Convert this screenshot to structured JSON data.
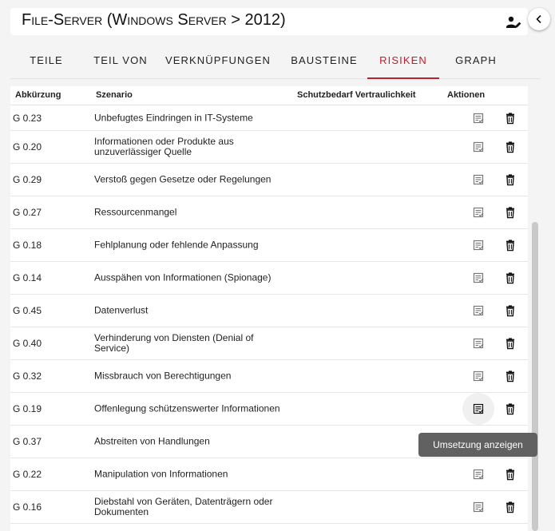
{
  "header": {
    "title": "File-Server (Windows Server > 2012)"
  },
  "tabs": [
    {
      "label": "Teile"
    },
    {
      "label": "Teil von"
    },
    {
      "label": "Verknüpfungen"
    },
    {
      "label": "Bausteine"
    },
    {
      "label": "Risiken",
      "active": true
    },
    {
      "label": "Graph"
    }
  ],
  "table": {
    "columns": [
      "Abkürzung",
      "Szenario",
      "Schutzbedarf Vertraulichkeit",
      "Aktionen"
    ],
    "rows": [
      {
        "id": "G 0.23",
        "scenario": "Unbefugtes Eindringen in IT-Systeme"
      },
      {
        "id": "G 0.20",
        "scenario": "Informationen oder Produkte aus unzuverlässiger Quelle"
      },
      {
        "id": "G 0.29",
        "scenario": "Verstoß gegen Gesetze oder Regelungen"
      },
      {
        "id": "G 0.27",
        "scenario": "Ressourcenmangel"
      },
      {
        "id": "G 0.18",
        "scenario": "Fehlplanung oder fehlende Anpassung"
      },
      {
        "id": "G 0.14",
        "scenario": "Ausspähen von Informationen (Spionage)"
      },
      {
        "id": "G 0.45",
        "scenario": "Datenverlust"
      },
      {
        "id": "G 0.40",
        "scenario": "Verhinderung von Diensten (Denial of Service)"
      },
      {
        "id": "G 0.32",
        "scenario": "Missbrauch von Berechtigungen"
      },
      {
        "id": "G 0.19",
        "scenario": "Offenlegung schützenswerter Informationen",
        "hovered": true
      },
      {
        "id": "G 0.37",
        "scenario": "Abstreiten von Handlungen"
      },
      {
        "id": "G 0.22",
        "scenario": "Manipulation von Informationen"
      },
      {
        "id": "G 0.16",
        "scenario": "Diebstahl von Geräten, Datenträgern oder Dokumenten"
      }
    ]
  },
  "tooltip": {
    "text": "Umsetzung anzeigen"
  },
  "icons": {
    "header_action": "person-edit-icon",
    "collapse": "chevron-left-icon",
    "view_action": "list-check-icon",
    "delete_action": "trash-icon"
  },
  "colors": {
    "accent": "#c0202a",
    "tooltip_bg": "#616161"
  }
}
